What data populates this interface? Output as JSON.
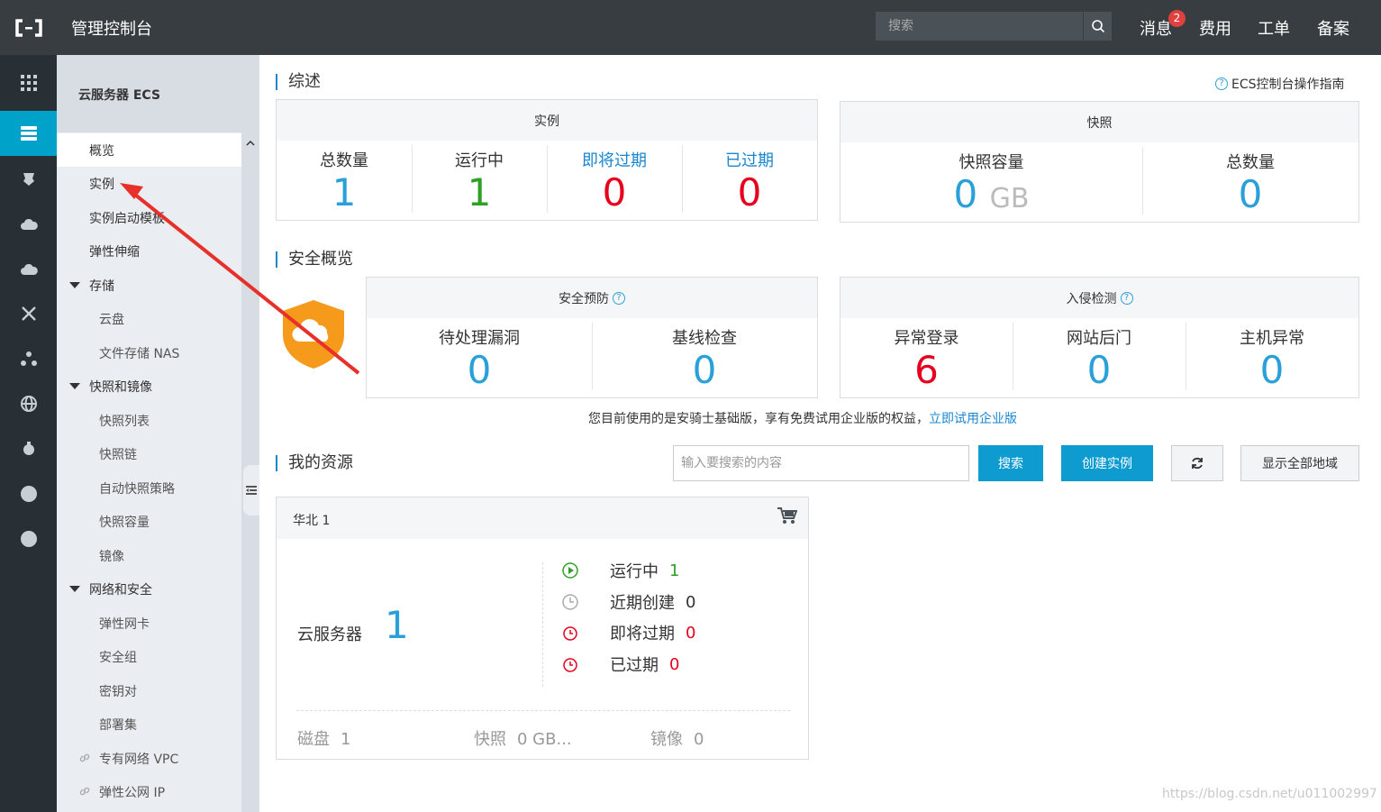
{
  "topbar": {
    "logo": "[-]",
    "title": "管理控制台",
    "search_placeholder": "搜索",
    "nav": [
      "消息",
      "费用",
      "工单",
      "备案"
    ],
    "message_badge": "2"
  },
  "sidebar": {
    "title": "云服务器 ECS",
    "items": [
      {
        "label": "概览",
        "type": "l1",
        "active": true
      },
      {
        "label": "实例",
        "type": "l1"
      },
      {
        "label": "实例启动模板",
        "type": "l1"
      },
      {
        "label": "弹性伸缩",
        "type": "l1"
      },
      {
        "label": "存储",
        "type": "grp"
      },
      {
        "label": "云盘",
        "type": "l2"
      },
      {
        "label": "文件存储 NAS",
        "type": "l2"
      },
      {
        "label": "快照和镜像",
        "type": "grp"
      },
      {
        "label": "快照列表",
        "type": "l2"
      },
      {
        "label": "快照链",
        "type": "l2"
      },
      {
        "label": "自动快照策略",
        "type": "l2"
      },
      {
        "label": "快照容量",
        "type": "l2"
      },
      {
        "label": "镜像",
        "type": "l2"
      },
      {
        "label": "网络和安全",
        "type": "grp"
      },
      {
        "label": "弹性网卡",
        "type": "l2"
      },
      {
        "label": "安全组",
        "type": "l2"
      },
      {
        "label": "密钥对",
        "type": "l2"
      },
      {
        "label": "部署集",
        "type": "l2"
      },
      {
        "label": "专有网络 VPC",
        "type": "l2"
      },
      {
        "label": "弹性公网 IP",
        "type": "l2"
      }
    ]
  },
  "overview": {
    "title": "综述",
    "guide": "ECS控制台操作指南",
    "instances": {
      "head": "实例",
      "cells": [
        {
          "label": "总数量",
          "value": "1"
        },
        {
          "label": "运行中",
          "value": "1"
        },
        {
          "label": "即将过期",
          "value": "0"
        },
        {
          "label": "已过期",
          "value": "0"
        }
      ]
    },
    "snapshots": {
      "head": "快照",
      "capacity_label": "快照容量",
      "capacity_value": "0",
      "capacity_unit": "GB",
      "total_label": "总数量",
      "total_value": "0"
    }
  },
  "security": {
    "title": "安全概览",
    "prevention": {
      "head": "安全预防",
      "cells": [
        {
          "label": "待处理漏洞",
          "value": "0"
        },
        {
          "label": "基线检查",
          "value": "0"
        }
      ]
    },
    "intrusion": {
      "head": "入侵检测",
      "cells": [
        {
          "label": "异常登录",
          "value": "6"
        },
        {
          "label": "网站后门",
          "value": "0"
        },
        {
          "label": "主机异常",
          "value": "0"
        }
      ]
    },
    "notice_text": "您目前使用的是安骑士基础版，享有免费试用企业版的权益，",
    "notice_link": "立即试用企业版"
  },
  "resources": {
    "title": "我的资源",
    "search_placeholder": "输入要搜索的内容",
    "search_button": "搜索",
    "create_button": "创建实例",
    "show_all_button": "显示全部地域",
    "region": {
      "name": "华北 1",
      "server_label": "云服务器",
      "server_count": "1",
      "stats": [
        {
          "label": "运行中",
          "value": "1"
        },
        {
          "label": "近期创建",
          "value": "0"
        },
        {
          "label": "即将过期",
          "value": "0"
        },
        {
          "label": "已过期",
          "value": "0"
        }
      ],
      "footer": [
        {
          "label": "磁盘",
          "value": "1"
        },
        {
          "label": "快照",
          "value": "0 GB..."
        },
        {
          "label": "镜像",
          "value": "0"
        }
      ]
    }
  },
  "watermark": "https://blog.csdn.net/u011002997",
  "colors": {
    "topbar": "#373d41",
    "rail": "#293035",
    "accent": "#00a2ca",
    "link": "#1a86d0",
    "value_blue": "#2aa0d8",
    "value_green": "#2fa026",
    "value_red": "#e6001d",
    "annotation_arrow": "#e8302a"
  }
}
